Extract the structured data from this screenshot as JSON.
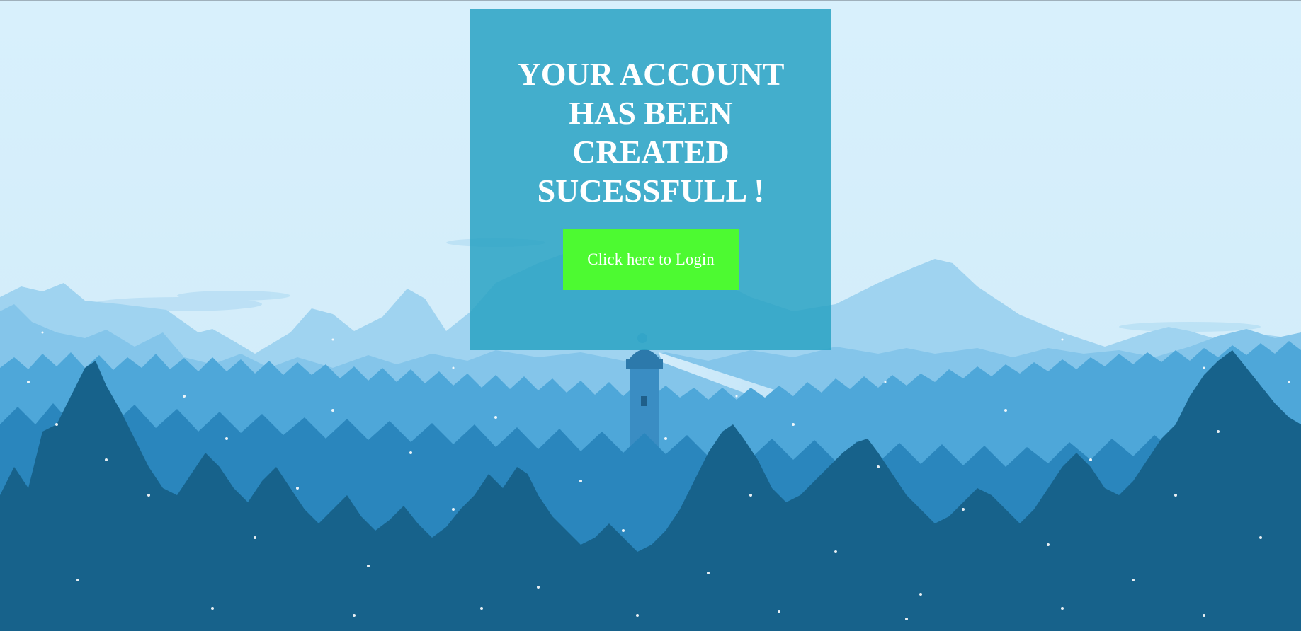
{
  "page": {
    "background_sky": "#d8f0fc",
    "colors": {
      "card": "#29a2c3",
      "button": "#4dfa31",
      "text": "#ffffff",
      "forest_dark": "#17628b",
      "forest_mid": "#2a86bd",
      "mountain_light": "#8ccaef"
    }
  },
  "card": {
    "title": "YOUR ACCOUNT HAS BEEN CREATED SUCESSFULL !",
    "button_label": "Click here to Login"
  }
}
